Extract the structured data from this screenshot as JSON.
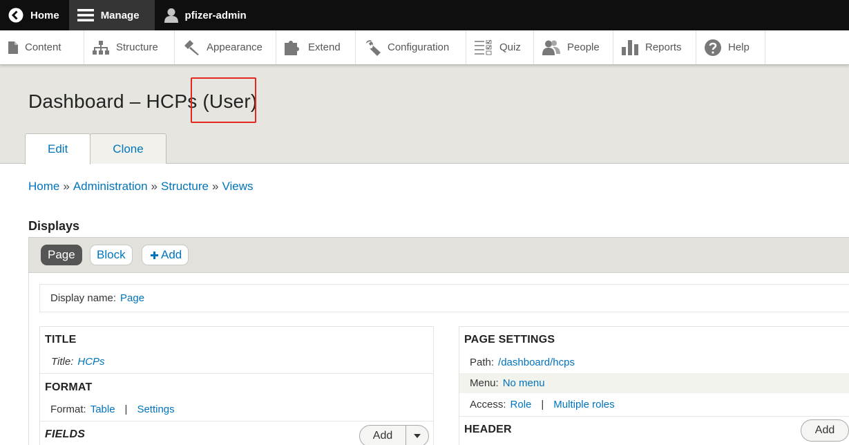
{
  "toolbar": {
    "home": "Home",
    "manage": "Manage",
    "user": "pfizer-admin"
  },
  "tray": {
    "items": [
      {
        "label": "Content",
        "icon": "document-icon"
      },
      {
        "label": "Structure",
        "icon": "sitemap-icon"
      },
      {
        "label": "Appearance",
        "icon": "paintbrush-icon"
      },
      {
        "label": "Extend",
        "icon": "puzzle-icon"
      },
      {
        "label": "Configuration",
        "icon": "wrench-icon"
      },
      {
        "label": "Quiz",
        "icon": "checklist-icon"
      },
      {
        "label": "People",
        "icon": "people-icon"
      },
      {
        "label": "Reports",
        "icon": "bar-chart-icon"
      },
      {
        "label": "Help",
        "icon": "question-icon"
      }
    ]
  },
  "page": {
    "title": "Dashboard – HCPs (User)"
  },
  "tabs": [
    "Edit",
    "Clone"
  ],
  "breadcrumb": [
    "Home",
    "Administration",
    "Structure",
    "Views"
  ],
  "breadcrumb_sep": "»",
  "displays": {
    "label": "Displays",
    "buttons": [
      "Page",
      "Block",
      "Add"
    ],
    "add_icon": "plus-icon"
  },
  "display_name": {
    "label": "Display name:",
    "value": "Page"
  },
  "left": {
    "title_section": "TITLE",
    "title_label": "Title:",
    "title_value": "HCPs",
    "format_section": "FORMAT",
    "format_label": "Format:",
    "format_value": "Table",
    "format_settings": "Settings",
    "fields_section": "FIELDS",
    "add_label": "Add"
  },
  "right": {
    "page_settings": "PAGE SETTINGS",
    "path_label": "Path:",
    "path_value": "/dashboard/hcps",
    "menu_label": "Menu:",
    "menu_value": "No menu",
    "access_label": "Access:",
    "access_value": "Role",
    "access_value2": "Multiple roles",
    "header_section": "HEADER",
    "add_label": "Add"
  },
  "colors": {
    "link": "#0074bd",
    "highlight": "#e5261d",
    "toolbar_bg": "#0f0f0f",
    "header_bg": "#e6e5df"
  }
}
